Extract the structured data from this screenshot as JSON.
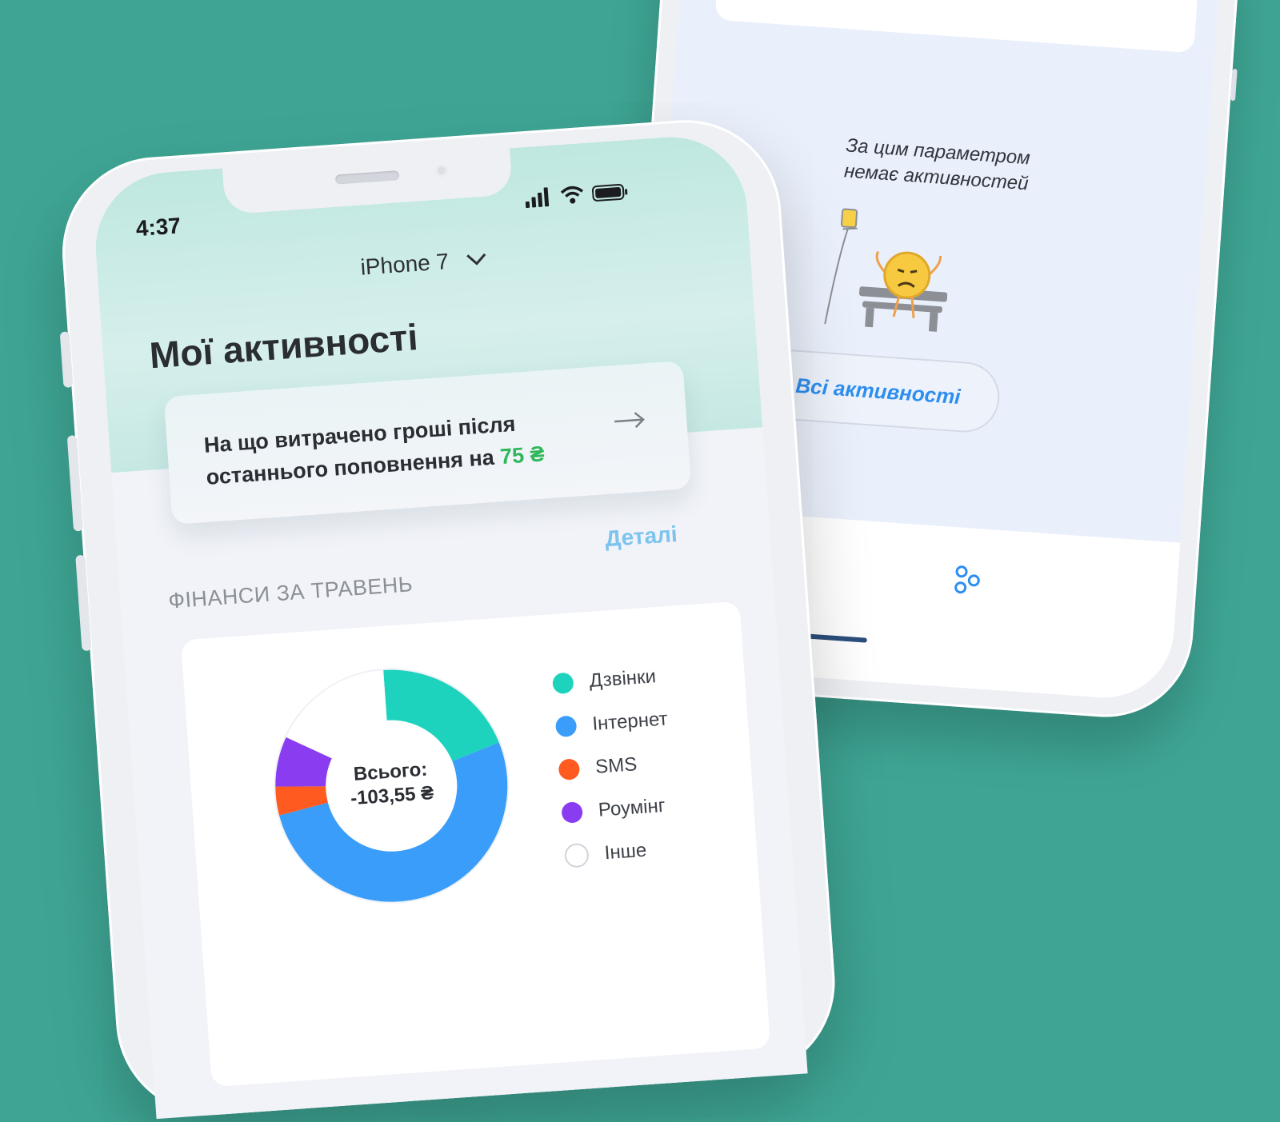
{
  "back_screen": {
    "empty_line1": "За цим параметром",
    "empty_line2": "немає активностей",
    "all_activities_button": "Всі активності",
    "tabs": [
      {
        "name": "activity-calendar-icon",
        "color": "#2e8ef0"
      },
      {
        "name": "services-icon",
        "color": "#2e8ef0"
      }
    ]
  },
  "status_bar": {
    "time": "4:37",
    "icons": [
      "signal-icon",
      "wifi-icon",
      "battery-icon"
    ]
  },
  "device_selector": {
    "label": "iPhone 7"
  },
  "page_title": "Мої активності",
  "spent_card": {
    "text": "На що витрачено гроші після останнього поповнення на",
    "amount": "75 ₴",
    "amount_color": "#2fb85a"
  },
  "finance_section": {
    "title": "ФІНАНСИ ЗА ТРАВЕНЬ",
    "details_link": "Деталі"
  },
  "total": {
    "label": "Всього:",
    "value": "-103,55 ₴"
  },
  "chart_data": {
    "type": "pie",
    "categories": [
      "Дзвінки",
      "Інтернет",
      "SMS",
      "Роумінг",
      "Інше"
    ],
    "values": [
      20,
      52,
      4,
      7,
      17
    ],
    "colors": [
      "#1ed3bd",
      "#3a9dfa",
      "#ff5a1f",
      "#8a3df0",
      "#ffffff"
    ],
    "center_label": "Всього:",
    "center_value": "-103,55 ₴"
  }
}
